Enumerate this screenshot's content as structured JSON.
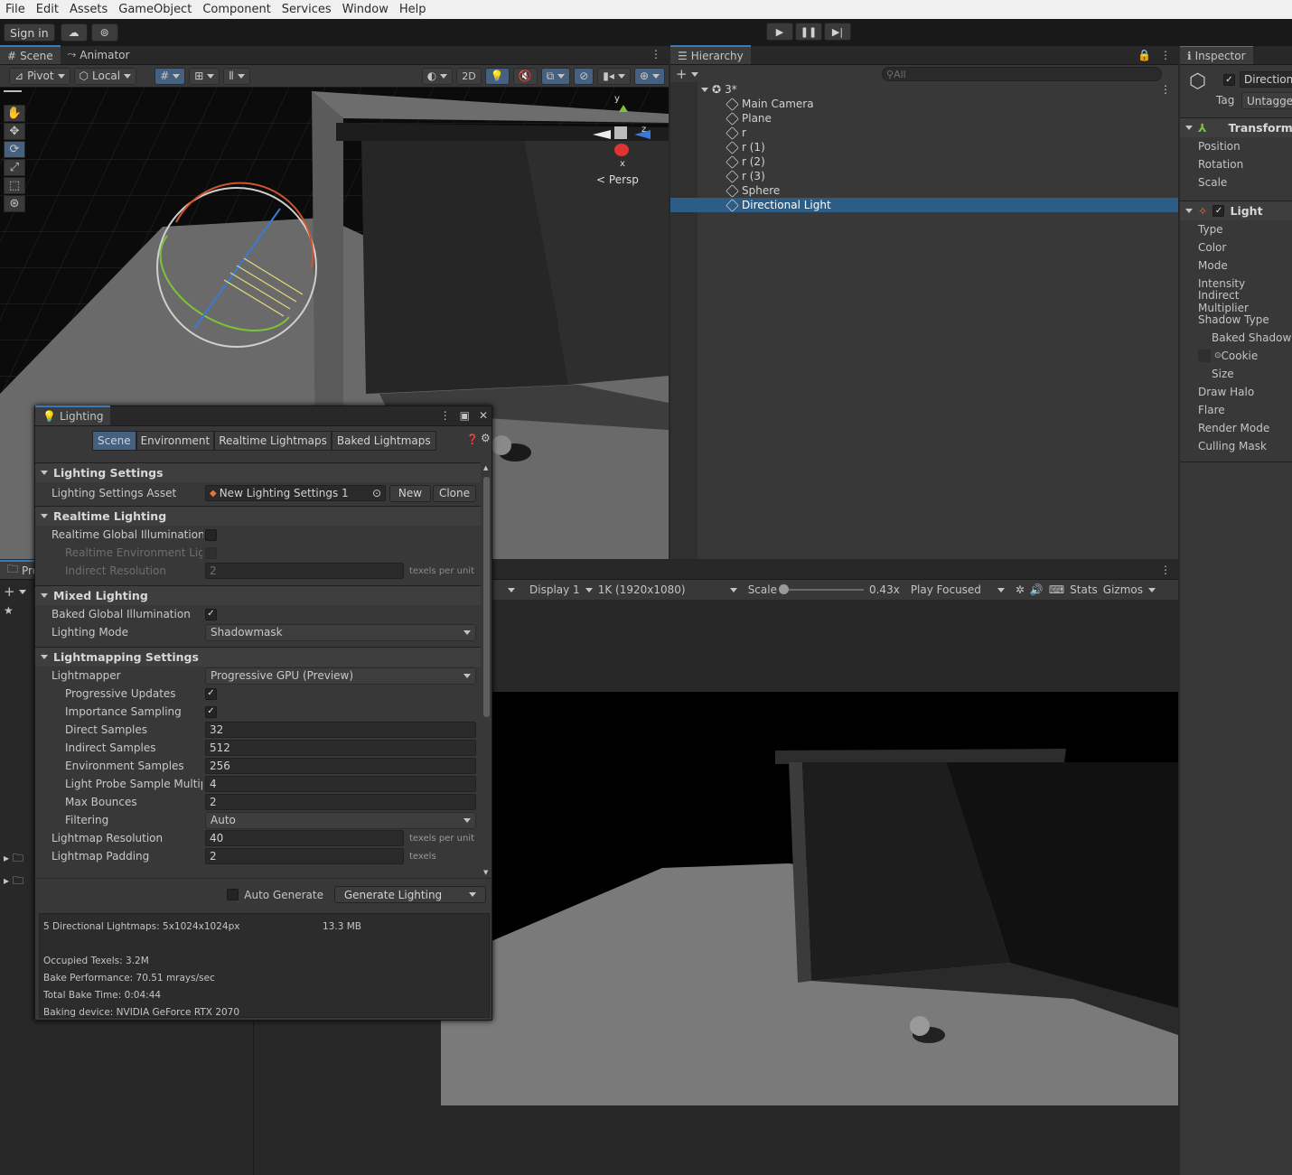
{
  "menu": [
    "File",
    "Edit",
    "Assets",
    "GameObject",
    "Component",
    "Services",
    "Window",
    "Help"
  ],
  "toolbar": {
    "sign_in": "Sign in"
  },
  "scene_tabs": {
    "scene": "Scene",
    "animator": "Animator"
  },
  "scene_toolbar": {
    "pivot": "Pivot",
    "local": "Local",
    "mode_2d": "2D"
  },
  "gizmo": {
    "persp": "Persp",
    "y": "y",
    "x": "x",
    "z": "z"
  },
  "hierarchy": {
    "tab": "Hierarchy",
    "search_placeholder": "All",
    "scene_name": "3*",
    "items": [
      "Main Camera",
      "Plane",
      "r",
      "r (1)",
      "r (2)",
      "r (3)",
      "Sphere",
      "Directional Light"
    ],
    "selected": "Directional Light"
  },
  "inspector": {
    "tab": "Inspector",
    "object_name": "Direction",
    "tag_label": "Tag",
    "tag_value": "Untagged",
    "transform": {
      "title": "Transform",
      "rows": [
        "Position",
        "Rotation",
        "Scale"
      ]
    },
    "light": {
      "title": "Light",
      "rows": [
        "Type",
        "Color",
        "Mode",
        "Intensity",
        "Indirect Multiplier",
        "Shadow Type",
        "Baked Shadow",
        "Cookie",
        "Size",
        "Draw Halo",
        "Flare",
        "Render Mode",
        "Culling Mask"
      ]
    }
  },
  "lighting": {
    "title": "Lighting",
    "tabs": [
      "Scene",
      "Environment",
      "Realtime Lightmaps",
      "Baked Lightmaps"
    ],
    "active_tab": "Scene",
    "lighting_settings": {
      "header": "Lighting Settings",
      "asset_label": "Lighting Settings Asset",
      "asset_value": "New Lighting Settings 1",
      "new": "New",
      "clone": "Clone"
    },
    "realtime": {
      "header": "Realtime Lighting",
      "gi": "Realtime Global Illumination",
      "env_light": "Realtime Environment Light",
      "indirect_res": "Indirect Resolution",
      "indirect_res_value": "2",
      "units": "texels per unit"
    },
    "mixed": {
      "header": "Mixed Lighting",
      "baked_gi": "Baked Global Illumination",
      "mode_label": "Lighting Mode",
      "mode_value": "Shadowmask"
    },
    "lightmapping": {
      "header": "Lightmapping Settings",
      "lightmapper_label": "Lightmapper",
      "lightmapper_value": "Progressive GPU (Preview)",
      "progressive_updates": "Progressive Updates",
      "importance_sampling": "Importance Sampling",
      "direct_samples": "Direct Samples",
      "direct_samples_value": "32",
      "indirect_samples": "Indirect Samples",
      "indirect_samples_value": "512",
      "env_samples": "Environment Samples",
      "env_samples_value": "256",
      "probe_mult": "Light Probe Sample Multipl",
      "probe_mult_value": "4",
      "max_bounces": "Max Bounces",
      "max_bounces_value": "2",
      "filtering": "Filtering",
      "filtering_value": "Auto",
      "resolution": "Lightmap Resolution",
      "resolution_value": "40",
      "resolution_units": "texels per unit",
      "padding": "Lightmap Padding",
      "padding_value": "2",
      "padding_units": "texels"
    },
    "auto_generate": "Auto Generate",
    "generate": "Generate Lighting",
    "stats": {
      "lightmaps": "5 Directional Lightmaps: 5x1024x1024px",
      "size": "13.3 MB",
      "texels": "Occupied Texels: 3.2M",
      "performance": "Bake Performance: 70.51 mrays/sec",
      "time": "Total Bake Time: 0:04:44",
      "device": "Baking device: NVIDIA GeForce RTX 2070"
    }
  },
  "project": {
    "tab": "Pro"
  },
  "game_toolbar": {
    "display": "Display 1",
    "resolution": "1K (1920x1080)",
    "scale_label": "Scale",
    "scale_value": "0.43x",
    "play_focused": "Play Focused",
    "stats": "Stats",
    "gizmos": "Gizmos"
  }
}
